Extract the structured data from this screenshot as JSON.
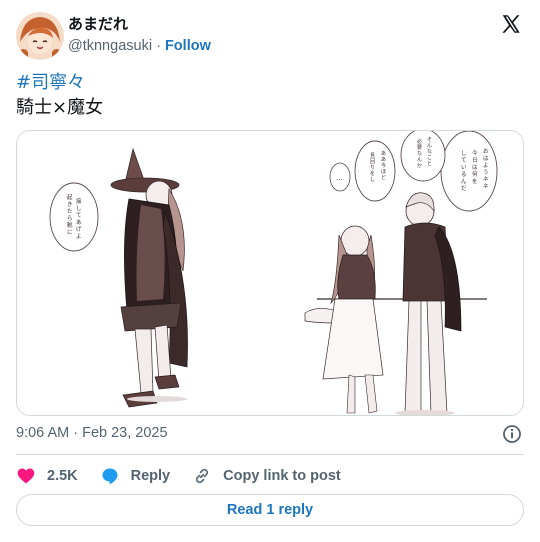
{
  "author": {
    "display_name": "あまだれ",
    "handle": "@tknngasuki",
    "separator": "·",
    "follow_label": "Follow"
  },
  "tweet": {
    "hashtag": "#司寧々",
    "text": "騎士×魔女"
  },
  "media": {
    "bubbles": {
      "left": "起きたら靴に\n接してあげよう",
      "right_top": "おはようネネ！\n今日は何を\nしているんだ？",
      "right_mid": "そんなことの時間\n必要なんかないの？",
      "right_low": "ああ、今ほどの部分を\n見回りをしています",
      "ellipsis": "…！"
    }
  },
  "meta": {
    "timestamp": "9:06 AM · Feb 23, 2025"
  },
  "actions": {
    "likes": "2.5K",
    "reply": "Reply",
    "copy_link": "Copy link to post"
  },
  "read_reply": "Read 1 reply",
  "colors": {
    "accent": "#1d76bd",
    "heart": "#f91880",
    "reply_icon": "#1d9bf0",
    "border": "#cfd9de",
    "muted": "#536471",
    "ink": "#3a2a2a"
  }
}
